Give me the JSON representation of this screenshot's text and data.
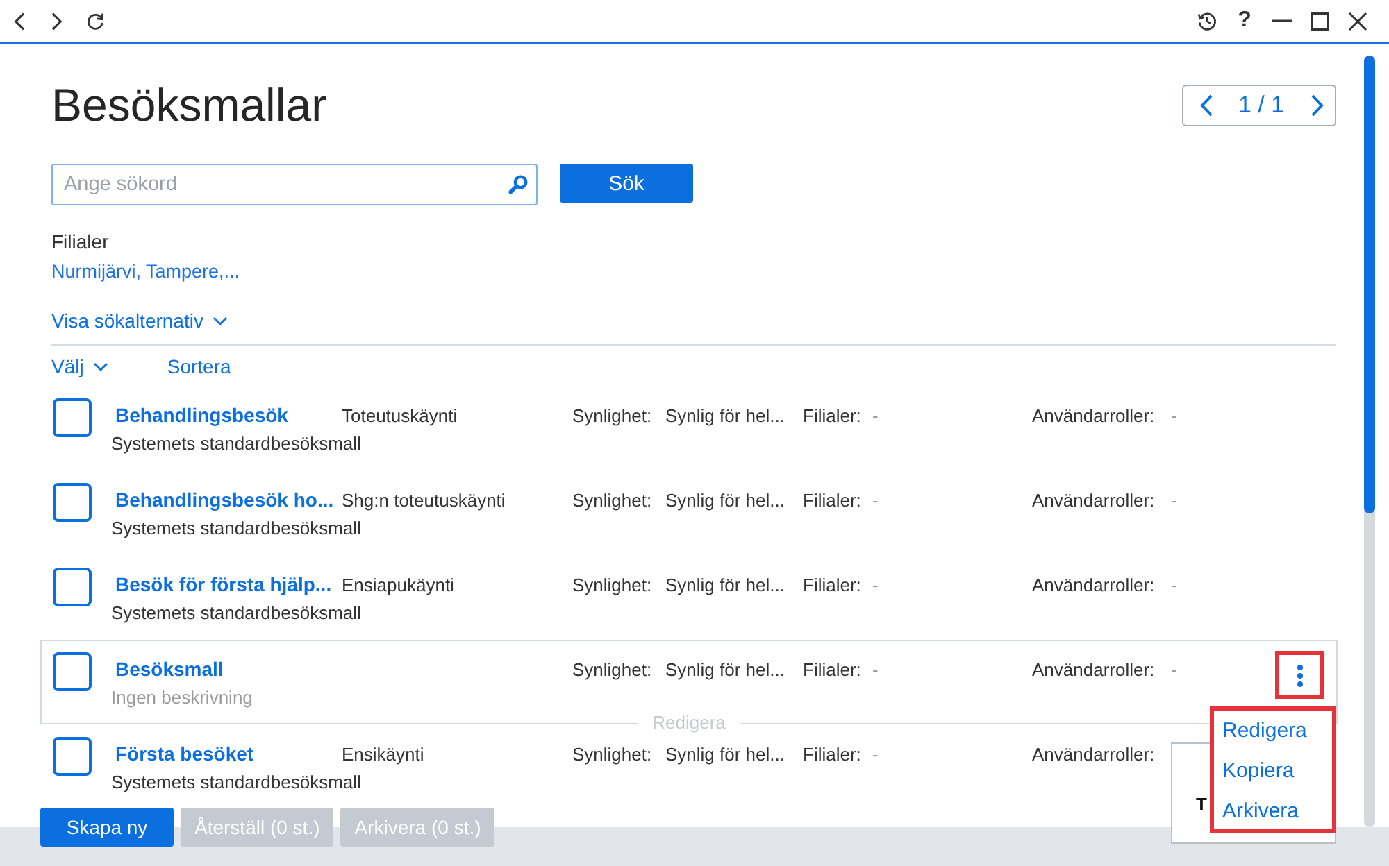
{
  "toolbar": {
    "help": "?"
  },
  "page": {
    "title": "Besöksmallar",
    "pager": "1 / 1"
  },
  "search": {
    "placeholder": "Ange sökord",
    "button": "Sök"
  },
  "filter": {
    "label": "Filialer",
    "value": "Nurmijärvi, Tampere,..."
  },
  "options_toggle": {
    "label": "Visa sökalternativ",
    "expanded": false
  },
  "list_actions": {
    "select": "Välj",
    "sort": "Sortera"
  },
  "rows": [
    {
      "checked": false,
      "hovered": false,
      "title": "Behandlingsbesök",
      "type": "Toteutuskäynti",
      "description": "Systemets standardbesöksmall",
      "description_muted": false,
      "visibility_label": "Synlighet:",
      "visibility": "Synlig för hel...",
      "branches_label": "Filialer:",
      "branches": "-",
      "roles_label": "Användarroller:",
      "roles": "-"
    },
    {
      "checked": false,
      "hovered": false,
      "title": "Behandlingsbesök ho...",
      "type": "Shg:n toteutuskäynti",
      "description": "Systemets standardbesöksmall",
      "description_muted": false,
      "visibility_label": "Synlighet:",
      "visibility": "Synlig för hel...",
      "branches_label": "Filialer:",
      "branches": "-",
      "roles_label": "Användarroller:",
      "roles": "-"
    },
    {
      "checked": false,
      "hovered": false,
      "title": "Besök för första hjälp...",
      "type": "Ensiapukäynti",
      "description": "Systemets standardbesöksmall",
      "description_muted": false,
      "visibility_label": "Synlighet:",
      "visibility": "Synlig för hel...",
      "branches_label": "Filialer:",
      "branches": "-",
      "roles_label": "Användarroller:",
      "roles": "-"
    },
    {
      "checked": false,
      "hovered": true,
      "title": "Besöksmall",
      "description": "Ingen beskrivning",
      "description_muted": true,
      "visibility_label": "Synlighet:",
      "visibility": "Synlig för hel...",
      "branches_label": "Filialer:",
      "branches": "-",
      "roles_label": "Användarroller:",
      "roles": "-",
      "hover_hint": "Redigera",
      "menu_button": {
        "highlighted": true
      },
      "menu": {
        "highlighted": true,
        "items": [
          "Redigera",
          "Kopiera",
          "Arkivera"
        ]
      }
    },
    {
      "checked": false,
      "hovered": false,
      "title": "Första besöket",
      "type": "Ensikäynti",
      "description": "Systemets standardbesöksmall",
      "description_muted": false,
      "visibility_label": "Synlighet:",
      "visibility": "Synlig för hel...",
      "branches_label": "Filialer:",
      "branches": "-",
      "roles_label": "Användarroller:",
      "popup": {
        "text": "T"
      }
    }
  ],
  "footer": {
    "buttons": [
      {
        "label": "Skapa ny",
        "disabled": false
      },
      {
        "label": "Återställ (0 st.)",
        "disabled": true
      },
      {
        "label": "Arkivera (0 st.)",
        "disabled": true
      }
    ]
  }
}
